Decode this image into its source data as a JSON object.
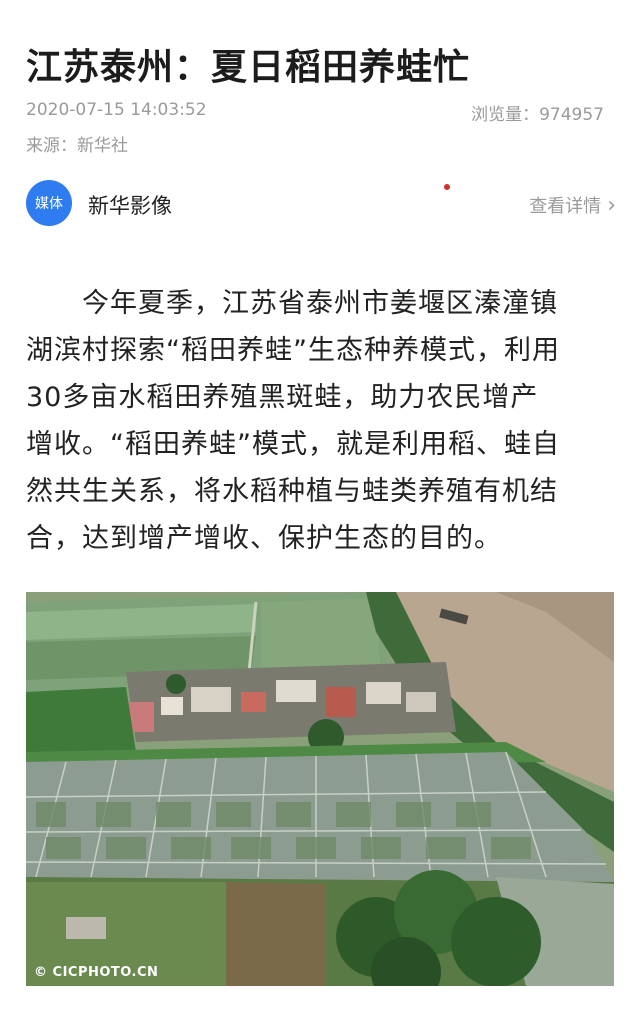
{
  "article": {
    "title": "江苏泰州：夏日稻田养蛙忙",
    "date": "2020-07-15 14:03:52",
    "views": "浏览量：974957",
    "source": "来源：新华社"
  },
  "author": {
    "avatar_label": "媒体",
    "name": "新华影像",
    "detail_link": "查看详情"
  },
  "body": {
    "lines": [
      "　　今年夏季，江苏省泰州市姜堰区溱潼镇",
      "湖滨村探索“稻田养蛙”生态种养模式，利用",
      "30多亩水稻田养殖黑斑蛙，助力农民增产",
      "增收。“稻田养蛙”模式，就是利用稻、蛙自",
      "然共生关系，将水稻种植与蛙类养殖有机结",
      "合，达到增产增收、保护生态的目的。"
    ]
  },
  "photo": {
    "watermark": "© CICPHOTO.CN"
  },
  "icons": {
    "chevron": "chevron-right-icon"
  }
}
